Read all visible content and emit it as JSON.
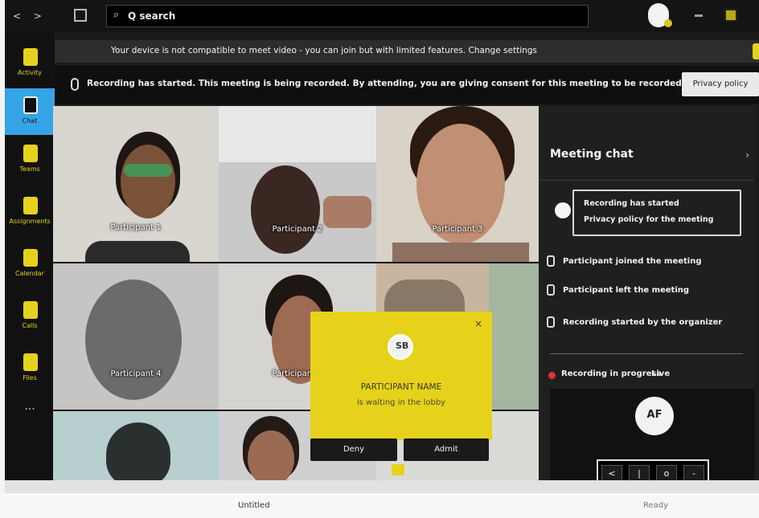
{
  "titlebar": {
    "nav": "< >",
    "search_text": "Q search"
  },
  "rail": {
    "items": [
      {
        "label": "Activity",
        "icon": "bell-icon"
      },
      {
        "label": "Chat",
        "icon": "chat-icon"
      },
      {
        "label": "Teams",
        "icon": "teams-icon"
      },
      {
        "label": "Assignments",
        "icon": "assignment-icon"
      },
      {
        "label": "Calendar",
        "icon": "calendar-icon"
      },
      {
        "label": "Calls",
        "icon": "phone-icon"
      },
      {
        "label": "Files",
        "icon": "file-icon"
      }
    ],
    "more": "..."
  },
  "notice": {
    "text": "Your device is not compatible to meet video - you can join but with limited features. Change settings"
  },
  "recording": {
    "text": "Recording has started. This meeting is being recorded. By attending, you are giving consent for this meeting to be recorded.",
    "button": "Privacy policy"
  },
  "tiles": [
    {
      "name": "Participant 1"
    },
    {
      "name": "Participant 2"
    },
    {
      "name": "Participant 3"
    },
    {
      "name": "Participant 4"
    },
    {
      "name": "Participant 5"
    }
  ],
  "popup": {
    "avatar": "SB",
    "title": "PARTICIPANT NAME",
    "subtitle": "is waiting in the lobby",
    "deny": "Deny",
    "admit": "Admit"
  },
  "panel": {
    "title": "Meeting chat",
    "info_line1": "Recording has started",
    "info_line2": "Privacy policy for the meeting",
    "rows": [
      "Participant joined the meeting",
      "Participant left the meeting",
      "Recording started by the organizer"
    ],
    "rec_line": "Recording in progress",
    "rec_status": "Live",
    "self_initials": "AF",
    "ctrls": [
      "<",
      "|",
      "o",
      "-"
    ]
  },
  "statusbar": {
    "text": "Untitled",
    "right": "Ready"
  },
  "colors": {
    "accent_yellow": "#e6d21b",
    "active_blue": "#34a4e6",
    "panel_bg": "#1f1f1f"
  }
}
